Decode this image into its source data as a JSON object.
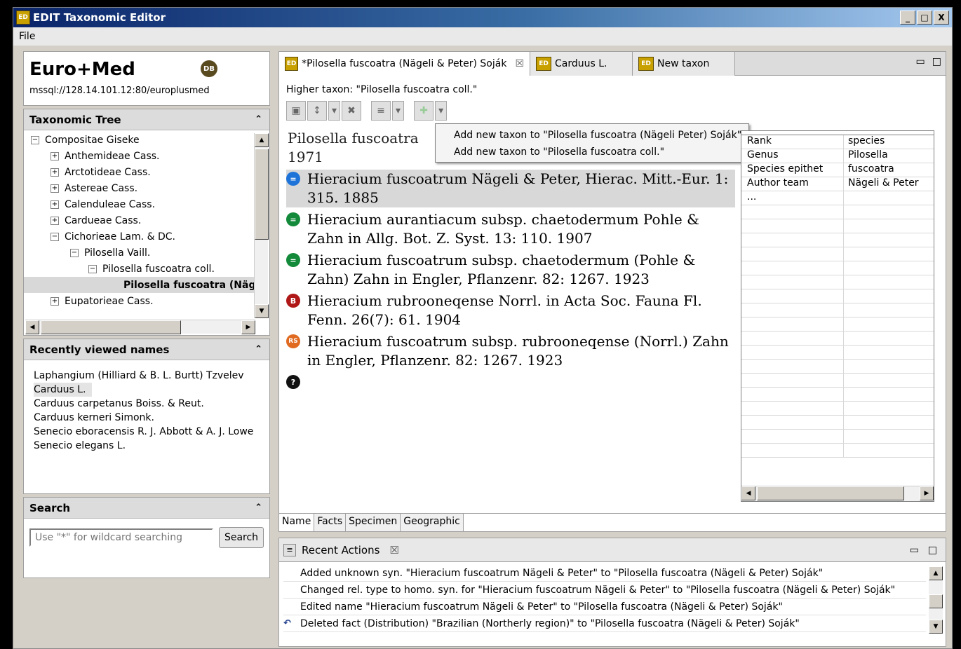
{
  "window": {
    "title": "EDIT Taxonomic Editor",
    "app_icon": "ED",
    "btn_min": "_",
    "btn_max": "□",
    "btn_close": "X"
  },
  "menu": {
    "file": "File"
  },
  "datasource": {
    "name": "Euro+Med",
    "badge": "DB",
    "url": "mssql://128.14.101.12:80/europlusmed"
  },
  "tree": {
    "header": "Taxonomic Tree",
    "items": [
      {
        "label": "Compositae Giseke",
        "expander": "−"
      },
      {
        "label": "Anthemideae Cass.",
        "expander": "+"
      },
      {
        "label": "Arctotideae Cass.",
        "expander": "+"
      },
      {
        "label": "Astereae Cass.",
        "expander": "+"
      },
      {
        "label": "Calenduleae Cass.",
        "expander": "+"
      },
      {
        "label": "Cardueae Cass.",
        "expander": "+"
      },
      {
        "label": "Cichorieae Lam. & DC.",
        "expander": "−"
      },
      {
        "label": "Pilosella Vaill.",
        "expander": "−"
      },
      {
        "label": "Pilosella fuscoatra coll.",
        "expander": "−"
      },
      {
        "label": "Pilosella fuscoatra (Näg",
        "expander": ""
      },
      {
        "label": "Eupatorieae Cass.",
        "expander": "+"
      }
    ]
  },
  "recent": {
    "header": "Recently viewed names",
    "items": [
      "Laphangium (Hilliard & B. L. Burtt) Tzvelev",
      "Carduus L.",
      "Carduus carpetanus Boiss. & Reut.",
      "Carduus kerneri Simonk.",
      "Senecio eboracensis R. J. Abbott & A. J. Lowe",
      "Senecio elegans L."
    ]
  },
  "search": {
    "header": "Search",
    "placeholder": "Use \"*\" for wildcard searching",
    "button": "Search"
  },
  "editor": {
    "tabs": [
      {
        "label": "*Pilosella fuscoatra (Nägeli & Peter) Soják",
        "icon": "ED",
        "close": "☒"
      },
      {
        "label": "Carduus L.",
        "icon": "ED"
      },
      {
        "label": "New taxon",
        "icon": "ED"
      }
    ],
    "view_min": "▭",
    "view_max": "□",
    "higher_taxon": "Higher taxon: \"Pilosella fuscoatra coll.\"",
    "toolbar": {
      "save": "▣",
      "move": "↕",
      "dropdown": "▾",
      "delete": "✖",
      "list": "≡",
      "add": "✚"
    },
    "accepted_name_line1": "Pilosella fuscoatra",
    "accepted_name_line2": "1971",
    "synonyms": [
      {
        "icon": "=",
        "color": "#1e73d8",
        "text": "Hieracium fuscoatrum Nägeli & Peter, Hierac. Mitt.-Eur. 1: 315. 1885",
        "highlight": true
      },
      {
        "icon": "=",
        "color": "#128a3a",
        "text": "Hieracium aurantiacum subsp. chaetodermum Pohle & Zahn in Allg. Bot. Z. Syst. 13: 110. 1907"
      },
      {
        "icon": "=",
        "color": "#128a3a",
        "text": "Hieracium fuscoatrum subsp. chaetodermum (Pohle & Zahn) Zahn in Engler, Pflanzenr. 82: 1267. 1923"
      },
      {
        "icon": "B",
        "color": "#b01818",
        "text": "Hieracium rubrooneqense Norrl. in Acta Soc. Fauna Fl. Fenn. 26(7): 61. 1904"
      },
      {
        "icon": "RS",
        "color": "#e06a20",
        "text": "Hieracium fuscoatrum subsp. rubrooneqense (Norrl.) Zahn in Engler, Pflanzenr. 82: 1267. 1923"
      },
      {
        "icon": "?",
        "color": "#111111",
        "text": ""
      }
    ],
    "context_menu": [
      "Add new taxon to \"Pilosella fuscoatra (Nägeli  Peter) Soják\"",
      "Add new taxon to \"Pilosella fuscoatra coll.\""
    ],
    "properties": [
      {
        "key": "Rank",
        "value": "species"
      },
      {
        "key": "Genus",
        "value": "Pilosella"
      },
      {
        "key": "Species epithet",
        "value": "fuscoatra"
      },
      {
        "key": "Author team",
        "value": "Nägeli & Peter"
      },
      {
        "key": "...",
        "value": ""
      }
    ],
    "bottom_tabs": [
      "Name",
      "Facts",
      "Specimen",
      "Geographic"
    ]
  },
  "actions": {
    "header": "Recent Actions",
    "close": "☒",
    "items": [
      {
        "icon": "",
        "text": "Added unknown syn. \"Hieracium fuscoatrum Nägeli & Peter\" to \"Pilosella fuscoatra (Nägeli & Peter) Soják\""
      },
      {
        "icon": "",
        "text": "Changed rel. type to homo. syn. for \"Hieracium fuscoatrum Nägeli & Peter\" to \"Pilosella fuscoatra (Nägeli & Peter) Soják\""
      },
      {
        "icon": "",
        "text": "Edited name \"Hieracium fuscoatrum Nägeli & Peter\" to \"Pilosella fuscoatra (Nägeli & Peter) Soják\""
      },
      {
        "icon": "↶",
        "text": "Deleted fact (Distribution) \"Brazilian (Northerly region)\" to \"Pilosella fuscoatra (Nägeli & Peter) Soják\""
      }
    ]
  }
}
